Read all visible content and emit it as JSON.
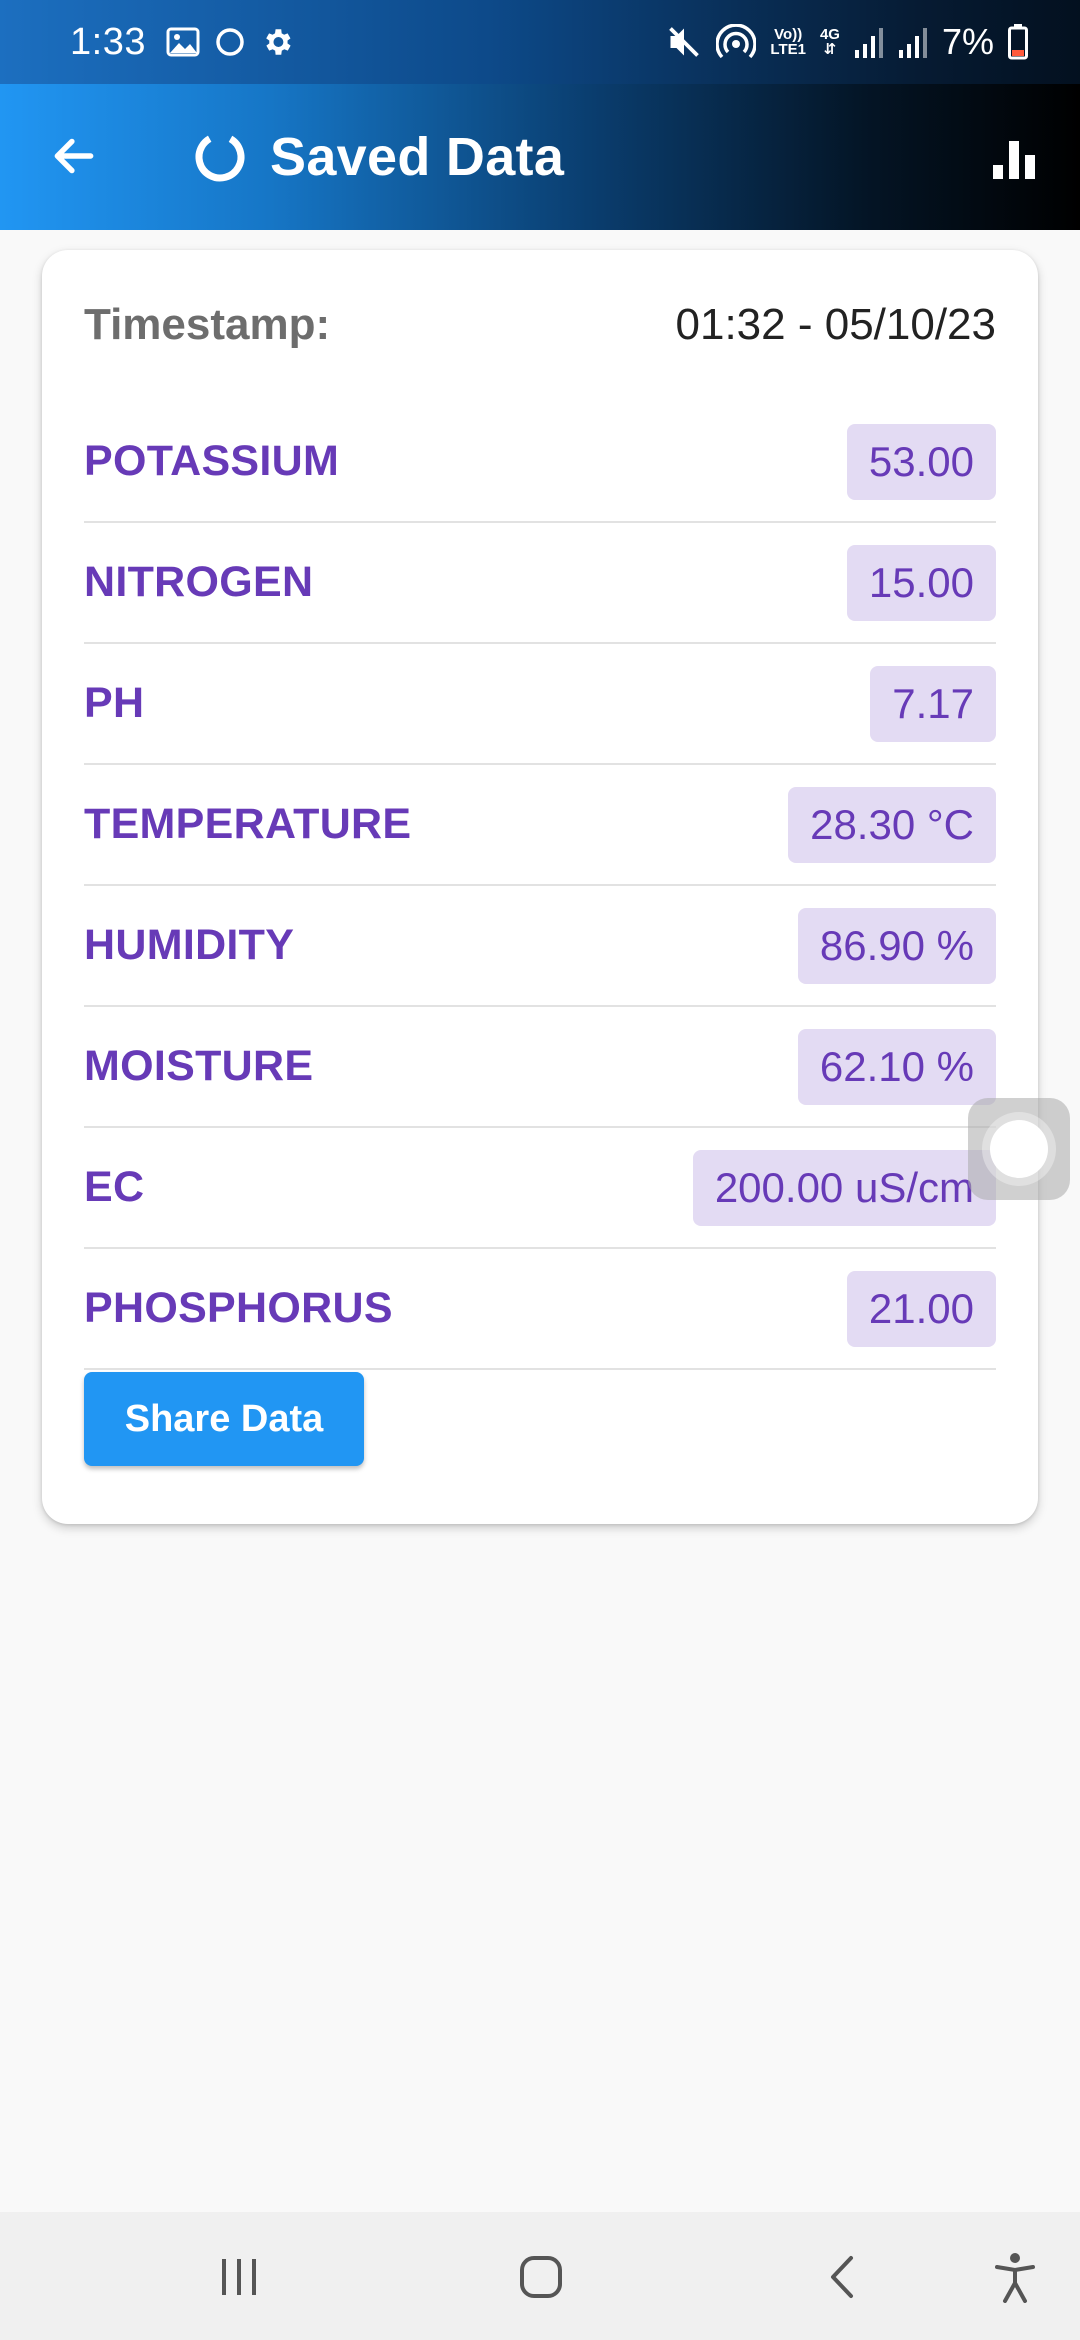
{
  "status_bar": {
    "time": "1:33",
    "volte_line1": "Vo))",
    "volte_line2": "LTE1",
    "network_type": "4G",
    "battery_percent": "7%",
    "icons": [
      "gallery-icon",
      "circle-icon",
      "settings-gear-icon",
      "mute-icon",
      "hotspot-icon",
      "signal-icon",
      "signal-icon",
      "battery-low-icon"
    ]
  },
  "app_bar": {
    "title": "Saved Data",
    "icons": [
      "back-arrow-icon",
      "loading-ring-icon",
      "bar-chart-icon"
    ]
  },
  "card": {
    "timestamp_label": "Timestamp:",
    "timestamp_value": "01:32 - 05/10/23",
    "rows": [
      {
        "label": "POTASSIUM",
        "value": "53.00"
      },
      {
        "label": "NITROGEN",
        "value": "15.00"
      },
      {
        "label": "PH",
        "value": "7.17"
      },
      {
        "label": "TEMPERATURE",
        "value": "28.30 °C"
      },
      {
        "label": "HUMIDITY",
        "value": "86.90 %"
      },
      {
        "label": "MOISTURE",
        "value": "62.10 %"
      },
      {
        "label": "EC",
        "value": "200.00 uS/cm"
      },
      {
        "label": "PHOSPHORUS",
        "value": "21.00"
      }
    ],
    "share_button": "Share Data"
  },
  "nav_bar": {
    "icons": [
      "recent-apps-icon",
      "home-icon",
      "back-icon",
      "accessibility-icon"
    ]
  },
  "colors": {
    "accent": "#2196f3",
    "label_purple": "#673ab7",
    "value_chip_bg": "#e3dbf3"
  }
}
